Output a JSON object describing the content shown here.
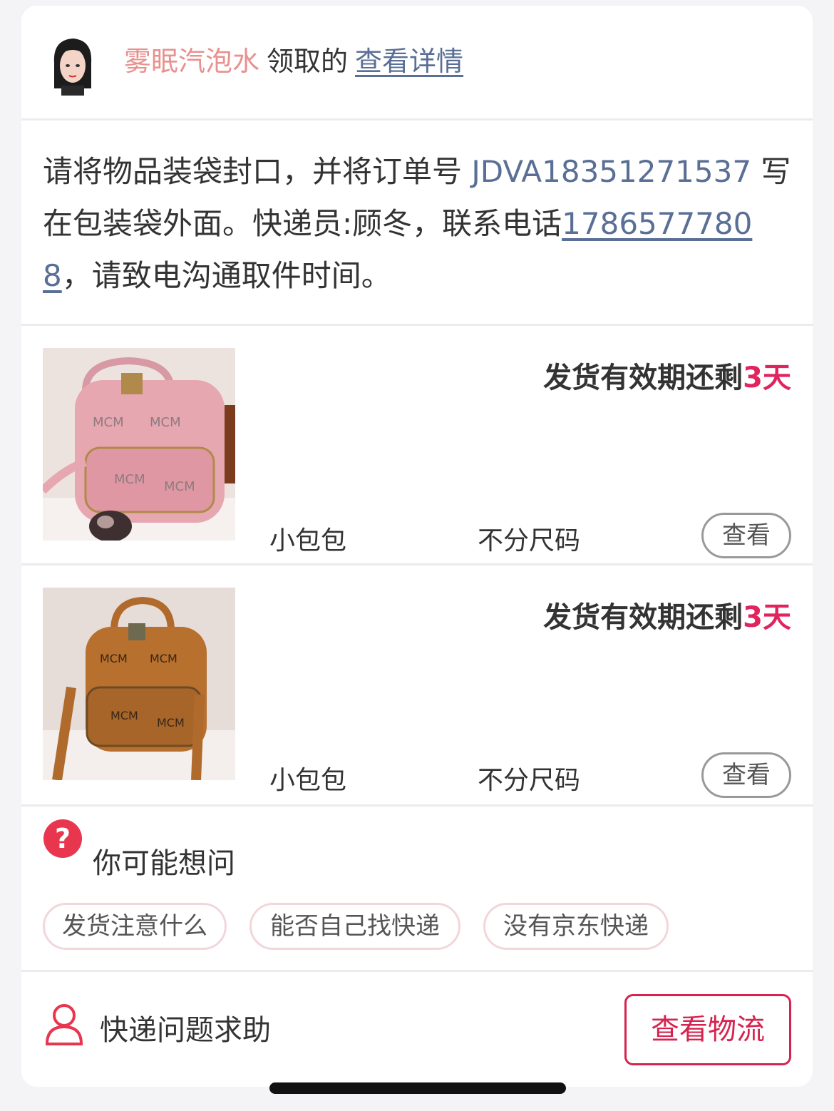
{
  "header": {
    "nickname": "雾眠汽泡水",
    "claimed_text": "领取的",
    "detail_link": "查看详情"
  },
  "instruction": {
    "part1": "请将物品装袋封口，并将订单号 ",
    "order_no": "JDVA18351271537",
    "part2": " 写在包装袋外面。快递员:顾冬，联系电话",
    "phone": "17865777808",
    "part3": "，请致电沟通取件时间。"
  },
  "items": [
    {
      "deadline_prefix": "发货有效期还剩",
      "deadline_days": "3天",
      "name": "小包包",
      "size": "不分尺码",
      "view_label": "查看",
      "thumb_color": "pink"
    },
    {
      "deadline_prefix": "发货有效期还剩",
      "deadline_days": "3天",
      "name": "小包包",
      "size": "不分尺码",
      "view_label": "查看",
      "thumb_color": "brown"
    }
  ],
  "faq": {
    "title": "你可能想问",
    "chips": [
      "发货注意什么",
      "能否自己找快递",
      "没有京东快递"
    ]
  },
  "footer": {
    "help_text": "快递问题求助",
    "logistics_button": "查看物流"
  },
  "colors": {
    "accent": "#d6234f",
    "link": "#5a6f95",
    "nickname": "#e8918f"
  }
}
